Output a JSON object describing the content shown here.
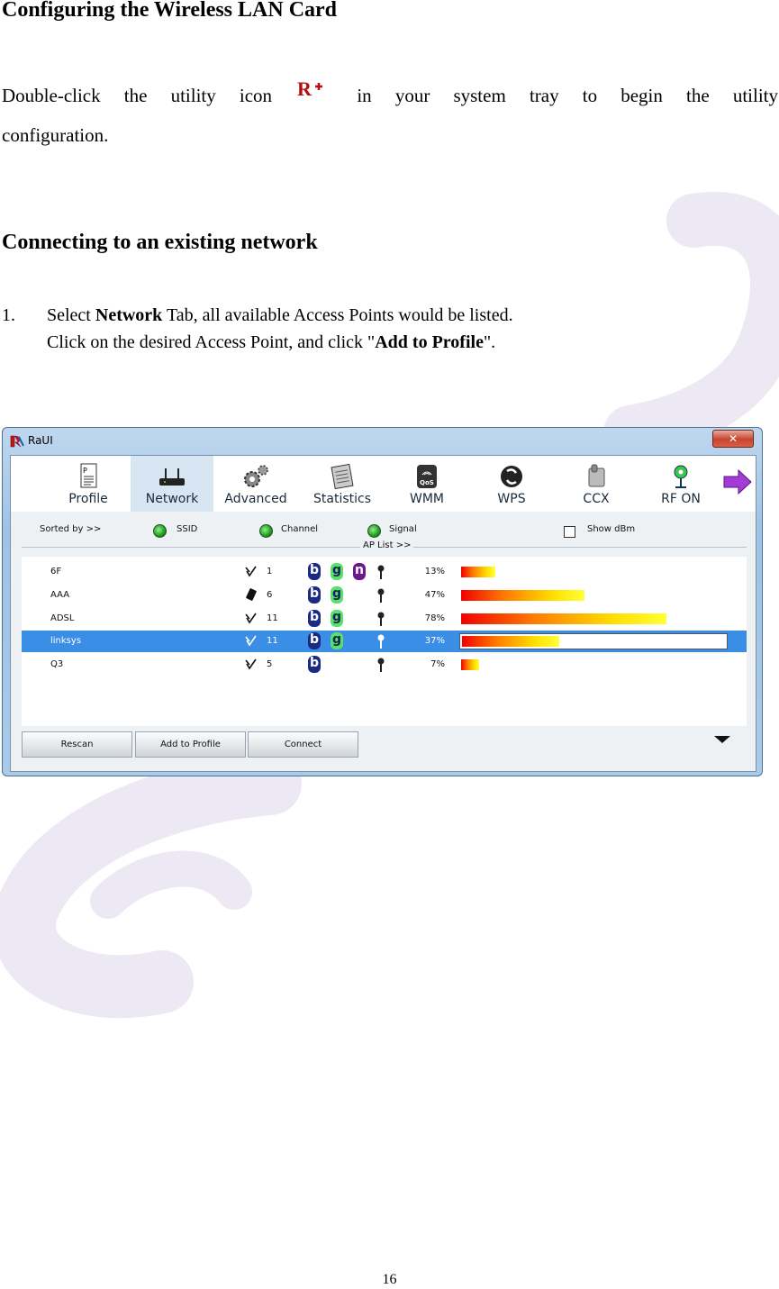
{
  "heading": "Configuring the Wireless LAN Card",
  "intro": {
    "words_line1": [
      "Double-click",
      "the",
      "utility",
      "icon"
    ],
    "words_line1b": [
      "in",
      "your",
      "system",
      "tray",
      "to",
      "begin",
      "the",
      "utility"
    ],
    "line2": "configuration."
  },
  "section_heading": "Connecting to an existing network",
  "step": {
    "number": "1.",
    "part1": "Select ",
    "bold1": "Network",
    "part2": " Tab, all available Access Points would be listed.",
    "line2_part1": "Click on the desired Access Point, and click ",
    "quote_open": "\"",
    "bold2": "Add to Profile",
    "quote_close": "\".",
    "dummy": ""
  },
  "window": {
    "title": "RaUI",
    "close_glyph": "✕",
    "toolbar": [
      {
        "label": "Profile",
        "icon": "profile-icon"
      },
      {
        "label": "Network",
        "icon": "network-icon"
      },
      {
        "label": "Advanced",
        "icon": "advanced-icon"
      },
      {
        "label": "Statistics",
        "icon": "statistics-icon"
      },
      {
        "label": "WMM",
        "icon": "wmm-icon"
      },
      {
        "label": "WPS",
        "icon": "wps-icon"
      },
      {
        "label": "CCX",
        "icon": "ccx-icon"
      },
      {
        "label": "RF ON",
        "icon": "rf-on-icon"
      }
    ],
    "sort": {
      "label": "Sorted by >>",
      "ssid": "SSID",
      "channel": "Channel",
      "signal": "Signal",
      "show_dbm": "Show dBm",
      "ap_list": "AP List >>"
    },
    "aps": [
      {
        "ssid": "6F",
        "channel": "1",
        "modes": [
          "b",
          "g",
          "n"
        ],
        "signal_pct": "13%",
        "signal": 13,
        "selected": false
      },
      {
        "ssid": "AAA",
        "channel": "6",
        "modes": [
          "b",
          "g"
        ],
        "signal_pct": "47%",
        "signal": 47,
        "selected": false
      },
      {
        "ssid": "ADSL",
        "channel": "11",
        "modes": [
          "b",
          "g"
        ],
        "signal_pct": "78%",
        "signal": 78,
        "selected": false
      },
      {
        "ssid": "linksys",
        "channel": "11",
        "modes": [
          "b",
          "g"
        ],
        "signal_pct": "37%",
        "signal": 37,
        "selected": true
      },
      {
        "ssid": "Q3",
        "channel": "5",
        "modes": [
          "b"
        ],
        "signal_pct": "7%",
        "signal": 7,
        "selected": false
      }
    ],
    "buttons": {
      "rescan": "Rescan",
      "add_to_profile": "Add to Profile",
      "connect": "Connect"
    }
  },
  "page_number": "16"
}
